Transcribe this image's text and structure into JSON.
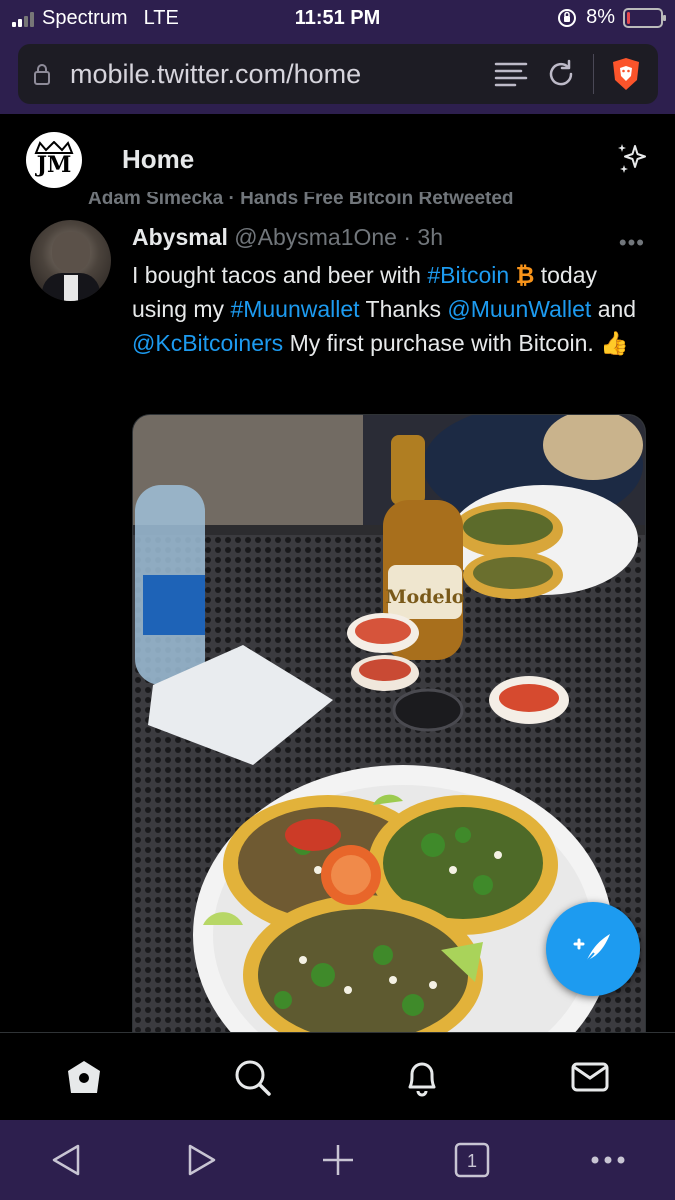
{
  "status_bar": {
    "carrier": "Spectrum",
    "network": "LTE",
    "time": "11:51 PM",
    "battery_percent": "8%",
    "battery_level": 0.08
  },
  "browser": {
    "url": "mobile.twitter.com/home",
    "tab_count": "1"
  },
  "header": {
    "avatar_initials": "JM",
    "title": "Home"
  },
  "retweet_context": "Adam Simecka · Hands Free Bitcoin Retweeted",
  "tweet": {
    "name": "Abysmal",
    "handle": "@Abysma1One",
    "time": "· 3h",
    "more": "•••",
    "text_1": "I bought tacos and beer with ",
    "hashtag_1": "#Bitcoin",
    "text_2": " today using my ",
    "hashtag_2": "#Muunwallet",
    "text_3": " Thanks ",
    "mention_1": "@MuunWallet",
    "text_4": " and ",
    "mention_2": "@KcBitcoiners",
    "text_5": " My first purchase with Bitcoin. ",
    "bitcoin_emoji": "₿",
    "thumbs_emoji": "👍"
  },
  "media": {
    "bottle_label": "Modelo"
  },
  "colors": {
    "accent": "#1d9bf0",
    "browser_chrome": "#2d1f4e",
    "background": "#000000",
    "bitcoin": "#f7931a",
    "battery_low": "#e5484d"
  },
  "icons": {
    "tabs": [
      "home-icon",
      "search-icon",
      "notifications-icon",
      "messages-icon"
    ],
    "browser_nav": [
      "back-icon",
      "forward-icon",
      "new-tab-icon",
      "tabs-icon",
      "menu-icon"
    ]
  }
}
